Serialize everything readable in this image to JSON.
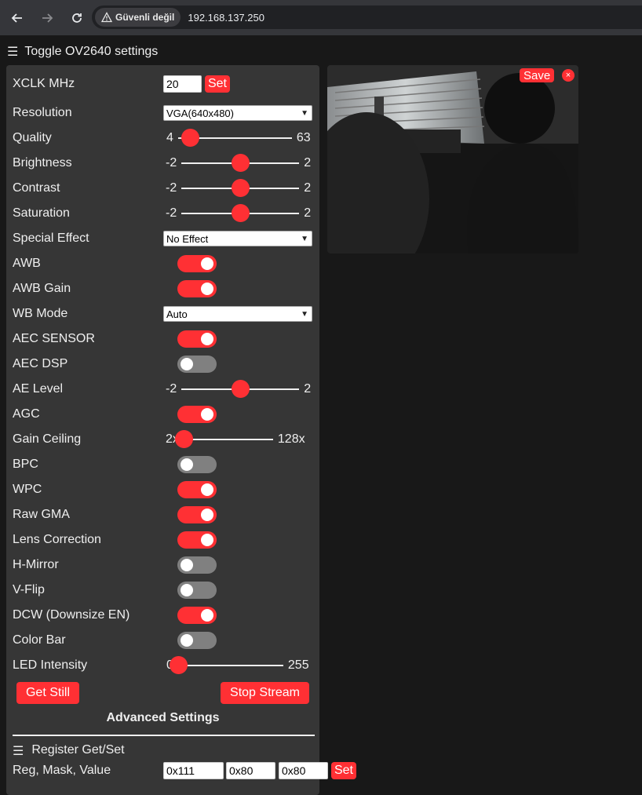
{
  "browser": {
    "security_label": "Güvenli değil",
    "url": "192.168.137.250"
  },
  "page": {
    "toggle_label": "Toggle OV2640 settings",
    "advanced_title": "Advanced Settings",
    "register_title": "Register Get/Set",
    "save_label": "Save",
    "close_label": "×"
  },
  "settings": {
    "xclk": {
      "label": "XCLK MHz",
      "value": "20",
      "button": "Set"
    },
    "resolution": {
      "label": "Resolution",
      "value": "VGA(640x480)"
    },
    "quality": {
      "label": "Quality",
      "min": "4",
      "max": "63",
      "value": 10
    },
    "brightness": {
      "label": "Brightness",
      "min": "-2",
      "max": "2",
      "value": 0
    },
    "contrast": {
      "label": "Contrast",
      "min": "-2",
      "max": "2",
      "value": 0
    },
    "saturation": {
      "label": "Saturation",
      "min": "-2",
      "max": "2",
      "value": 0
    },
    "special_effect": {
      "label": "Special Effect",
      "value": "No Effect"
    },
    "awb": {
      "label": "AWB",
      "on": true
    },
    "awb_gain": {
      "label": "AWB Gain",
      "on": true
    },
    "wb_mode": {
      "label": "WB Mode",
      "value": "Auto"
    },
    "aec_sensor": {
      "label": "AEC SENSOR",
      "on": true
    },
    "aec_dsp": {
      "label": "AEC DSP",
      "on": false
    },
    "ae_level": {
      "label": "AE Level",
      "min": "-2",
      "max": "2",
      "value": 0
    },
    "agc": {
      "label": "AGC",
      "on": true
    },
    "gain_ceiling": {
      "label": "Gain Ceiling",
      "min": "2x",
      "max": "128x",
      "value": 0
    },
    "bpc": {
      "label": "BPC",
      "on": false
    },
    "wpc": {
      "label": "WPC",
      "on": true
    },
    "raw_gma": {
      "label": "Raw GMA",
      "on": true
    },
    "lens_correction": {
      "label": "Lens Correction",
      "on": true
    },
    "hmirror": {
      "label": "H-Mirror",
      "on": false
    },
    "vflip": {
      "label": "V-Flip",
      "on": false
    },
    "dcw": {
      "label": "DCW (Downsize EN)",
      "on": true
    },
    "colorbar": {
      "label": "Color Bar",
      "on": false
    },
    "led_intensity": {
      "label": "LED Intensity",
      "min": "0",
      "max": "255",
      "value": 0
    }
  },
  "buttons": {
    "get_still": "Get Still",
    "stop_stream": "Stop Stream"
  },
  "register": {
    "label": "Reg, Mask, Value",
    "reg": "0x111",
    "mask": "0x80",
    "value": "0x80",
    "button": "Set"
  },
  "colors": {
    "accent": "#ff3034",
    "panel": "#363636",
    "background": "#181818"
  }
}
